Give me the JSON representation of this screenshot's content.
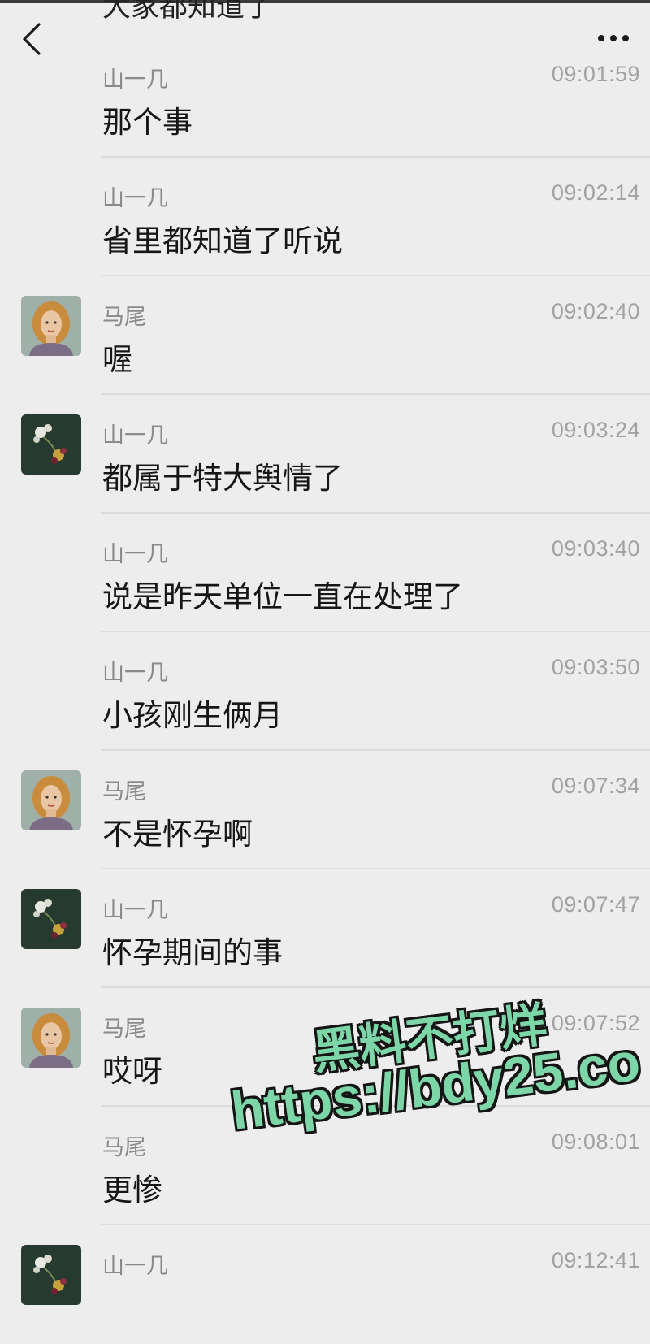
{
  "header": {
    "back_icon": "chevron-left-icon",
    "more_icon": "more-dots-icon"
  },
  "partial_message": "大家都知道了",
  "messages": [
    {
      "sender": "山一几",
      "time": "09:01:59",
      "text": "那个事",
      "avatar": "none"
    },
    {
      "sender": "山一几",
      "time": "09:02:14",
      "text": "省里都知道了听说",
      "avatar": "none"
    },
    {
      "sender": "马尾",
      "time": "09:02:40",
      "text": "喔",
      "avatar": "portrait-avatar"
    },
    {
      "sender": "山一几",
      "time": "09:03:24",
      "text": "都属于特大舆情了",
      "avatar": "flower-avatar"
    },
    {
      "sender": "山一几",
      "time": "09:03:40",
      "text": "说是昨天单位一直在处理了",
      "avatar": "none"
    },
    {
      "sender": "山一几",
      "time": "09:03:50",
      "text": "小孩刚生俩月",
      "avatar": "none"
    },
    {
      "sender": "马尾",
      "time": "09:07:34",
      "text": "不是怀孕啊",
      "avatar": "portrait-avatar"
    },
    {
      "sender": "山一几",
      "time": "09:07:47",
      "text": "怀孕期间的事",
      "avatar": "flower-avatar"
    },
    {
      "sender": "马尾",
      "time": "09:07:52",
      "text": "哎呀",
      "avatar": "portrait-avatar"
    },
    {
      "sender": "马尾",
      "time": "09:08:01",
      "text": "更惨",
      "avatar": "none"
    },
    {
      "sender": "山一几",
      "time": "09:12:41",
      "text": "",
      "avatar": "flower-avatar"
    }
  ],
  "watermark": {
    "line1": "黑料不打烊",
    "line2": "https://bdy25.co",
    "color": "#7dd6a8"
  }
}
